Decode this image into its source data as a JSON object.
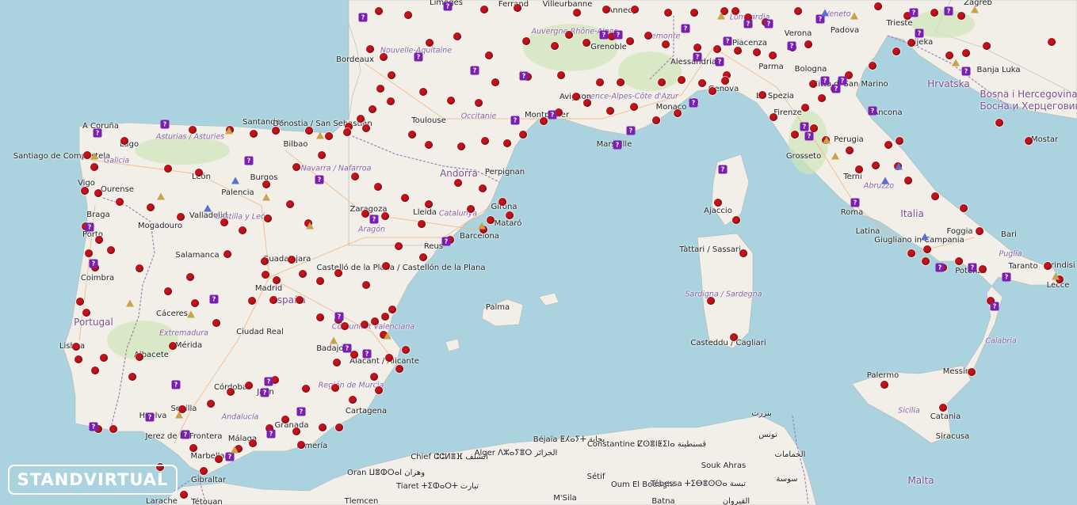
{
  "logo": {
    "text": "STANDVIRTUAL"
  },
  "colors": {
    "water": "#aad3df",
    "land": "#f2efe9",
    "forest": "#cfe6b6",
    "border": "#9e83b5",
    "road": "#f3b37a",
    "dot": "#c0141b",
    "pin": "#7a1fb0"
  },
  "labels": [
    {
      "text": "Limoges",
      "kind": "city"
    },
    {
      "text": "Ferrand",
      "kind": "city"
    },
    {
      "text": "Villeurbanne",
      "kind": "city"
    },
    {
      "text": "Annecy",
      "kind": "city"
    },
    {
      "text": "Zagreb",
      "kind": "city"
    },
    {
      "text": "Nouvelle-Aquitaine",
      "kind": "region"
    },
    {
      "text": "Bordeaux",
      "kind": "city"
    },
    {
      "text": "Grenoble",
      "kind": "city"
    },
    {
      "text": "Auvergne-Rhône-Alpes",
      "kind": "region"
    },
    {
      "text": "Piemonte",
      "kind": "region"
    },
    {
      "text": "Lombardia",
      "kind": "region"
    },
    {
      "text": "Verona",
      "kind": "city"
    },
    {
      "text": "Padova",
      "kind": "city"
    },
    {
      "text": "Veneto",
      "kind": "region"
    },
    {
      "text": "Trieste",
      "kind": "city"
    },
    {
      "text": "Rijeka",
      "kind": "city"
    },
    {
      "text": "Banja Luka",
      "kind": "city"
    },
    {
      "text": "Alessandria",
      "kind": "city"
    },
    {
      "text": "Piacenza",
      "kind": "city"
    },
    {
      "text": "Parma",
      "kind": "city"
    },
    {
      "text": "Bologna",
      "kind": "city"
    },
    {
      "text": "Città di San Marino",
      "kind": "city"
    },
    {
      "text": "Hrvatska",
      "kind": "country"
    },
    {
      "text": "Bosna i Hercegovina",
      "kind": "country"
    },
    {
      "text": "Босна и Херцеговина",
      "kind": "country"
    },
    {
      "text": "Provence-Alpes-Côte d'Azur",
      "kind": "region"
    },
    {
      "text": "Avignon",
      "kind": "city"
    },
    {
      "text": "Montpellier",
      "kind": "city"
    },
    {
      "text": "Occitanie",
      "kind": "region"
    },
    {
      "text": "Toulouse",
      "kind": "city"
    },
    {
      "text": "Monaco",
      "kind": "city"
    },
    {
      "text": "Genova",
      "kind": "city"
    },
    {
      "text": "La Spezia",
      "kind": "city"
    },
    {
      "text": "Firenze",
      "kind": "city"
    },
    {
      "text": "Ancona",
      "kind": "city"
    },
    {
      "text": "A Coruña",
      "kind": "city"
    },
    {
      "text": "Asturias / Asturies",
      "kind": "region"
    },
    {
      "text": "Santander",
      "kind": "city"
    },
    {
      "text": "Donostia / San Sebastián",
      "kind": "city"
    },
    {
      "text": "Lugo",
      "kind": "city"
    },
    {
      "text": "Bilbao",
      "kind": "city"
    },
    {
      "text": "Marseille",
      "kind": "city"
    },
    {
      "text": "Perugia",
      "kind": "city"
    },
    {
      "text": "Mostar",
      "kind": "city"
    },
    {
      "text": "Santiago de Compostela",
      "kind": "city"
    },
    {
      "text": "Galicia",
      "kind": "region"
    },
    {
      "text": "Navarra / Nafarroa",
      "kind": "region"
    },
    {
      "text": "Andorra",
      "kind": "country"
    },
    {
      "text": "Grosseto",
      "kind": "city"
    },
    {
      "text": "Vigo",
      "kind": "city"
    },
    {
      "text": "León",
      "kind": "city"
    },
    {
      "text": "Burgos",
      "kind": "city"
    },
    {
      "text": "Perpignan",
      "kind": "city"
    },
    {
      "text": "Ourense",
      "kind": "city"
    },
    {
      "text": "Palencia",
      "kind": "city"
    },
    {
      "text": "Terni",
      "kind": "city"
    },
    {
      "text": "Abruzzo",
      "kind": "region"
    },
    {
      "text": "Zaragoza",
      "kind": "city"
    },
    {
      "text": "Girona",
      "kind": "city"
    },
    {
      "text": "Ajaccio",
      "kind": "city"
    },
    {
      "text": "Braga",
      "kind": "city"
    },
    {
      "text": "Valladolid",
      "kind": "city"
    },
    {
      "text": "Castilla y León",
      "kind": "region"
    },
    {
      "text": "Lleida",
      "kind": "city"
    },
    {
      "text": "Catalunya",
      "kind": "region"
    },
    {
      "text": "Roma",
      "kind": "city"
    },
    {
      "text": "Italia",
      "kind": "country"
    },
    {
      "text": "Mogadouro",
      "kind": "city"
    },
    {
      "text": "Aragón",
      "kind": "region"
    },
    {
      "text": "Mataró",
      "kind": "city"
    },
    {
      "text": "Porto",
      "kind": "city"
    },
    {
      "text": "Barcelona",
      "kind": "city"
    },
    {
      "text": "Latina",
      "kind": "city"
    },
    {
      "text": "Foggia",
      "kind": "city"
    },
    {
      "text": "Bari",
      "kind": "city"
    },
    {
      "text": "Tàttari / Sassari",
      "kind": "city"
    },
    {
      "text": "Giugliano in Campania",
      "kind": "city"
    },
    {
      "text": "Puglia",
      "kind": "region"
    },
    {
      "text": "Salamanca",
      "kind": "city"
    },
    {
      "text": "Guadalajara",
      "kind": "city"
    },
    {
      "text": "Reus",
      "kind": "city"
    },
    {
      "text": "Coimbra",
      "kind": "city"
    },
    {
      "text": "Castelló de la Plana / Castellón de la Plana",
      "kind": "city"
    },
    {
      "text": "Potenza",
      "kind": "city"
    },
    {
      "text": "Taranto",
      "kind": "city"
    },
    {
      "text": "Brindisi",
      "kind": "city"
    },
    {
      "text": "Madrid",
      "kind": "city"
    },
    {
      "text": "España",
      "kind": "country"
    },
    {
      "text": "Sardigna / Sardegna",
      "kind": "region"
    },
    {
      "text": "Lecce",
      "kind": "city"
    },
    {
      "text": "Palma",
      "kind": "city"
    },
    {
      "text": "Portugal",
      "kind": "country"
    },
    {
      "text": "Cáceres",
      "kind": "city"
    },
    {
      "text": "Ciudad Real",
      "kind": "city"
    },
    {
      "text": "Comunitat Valenciana",
      "kind": "region"
    },
    {
      "text": "Extremadura",
      "kind": "region"
    },
    {
      "text": "Casteddu / Cagliari",
      "kind": "city"
    },
    {
      "text": "Calabria",
      "kind": "region"
    },
    {
      "text": "Lisboa",
      "kind": "city"
    },
    {
      "text": "Mérida",
      "kind": "city"
    },
    {
      "text": "Albacete",
      "kind": "city"
    },
    {
      "text": "Badajoz",
      "kind": "city"
    },
    {
      "text": "Alacant / Alicante",
      "kind": "city"
    },
    {
      "text": "Messina",
      "kind": "city"
    },
    {
      "text": "Palermo",
      "kind": "city"
    },
    {
      "text": "Córdoba",
      "kind": "city"
    },
    {
      "text": "Jaén",
      "kind": "city"
    },
    {
      "text": "Región de Murcia",
      "kind": "region"
    },
    {
      "text": "Sevilla",
      "kind": "city"
    },
    {
      "text": "Cartagena",
      "kind": "city"
    },
    {
      "text": "Huelva",
      "kind": "city"
    },
    {
      "text": "Andalucía",
      "kind": "region"
    },
    {
      "text": "Sicilia",
      "kind": "region"
    },
    {
      "text": "Catania",
      "kind": "city"
    },
    {
      "text": "Jerez de la Frontera",
      "kind": "city"
    },
    {
      "text": "Granada",
      "kind": "city"
    },
    {
      "text": "Málaga",
      "kind": "city"
    },
    {
      "text": "Siracusa",
      "kind": "city"
    },
    {
      "text": "Almería",
      "kind": "city"
    },
    {
      "text": "Marbella",
      "kind": "city"
    },
    {
      "text": "Béjaïa ⵟⵃⴰⵢⵜ بجاية",
      "kind": "city"
    },
    {
      "text": "Constantine ⵇⵙⴻⵏⵟⵉⵏⴰ قسنطينة",
      "kind": "city"
    },
    {
      "text": "بنزرت",
      "kind": "city"
    },
    {
      "text": "تونس",
      "kind": "city"
    },
    {
      "text": "الحمامات",
      "kind": "city"
    },
    {
      "text": "Chief ⵛⵛⵍⴻⴼ الشلف",
      "kind": "city"
    },
    {
      "text": "Alger ⴷⵣⴰⵢⴻⵔ الجزائر",
      "kind": "city"
    },
    {
      "text": "Sétif",
      "kind": "city"
    },
    {
      "text": "Souk Ahras",
      "kind": "city"
    },
    {
      "text": "Gibraltar",
      "kind": "city"
    },
    {
      "text": "Oran ⵡⴻⵀⵔⴰⵏ وهران",
      "kind": "city"
    },
    {
      "text": "Tiaret ⵜⵉⵀⴰⵔⵜ تيارت",
      "kind": "city"
    },
    {
      "text": "Oum El Bouaghi",
      "kind": "city"
    },
    {
      "text": "Tébessa ⵜⵉⴱⴻⵙⵙⴰ تبسة",
      "kind": "city"
    },
    {
      "text": "سوسة",
      "kind": "city"
    },
    {
      "text": "Malta",
      "kind": "country"
    },
    {
      "text": "Larache",
      "kind": "city"
    },
    {
      "text": "Tétouan",
      "kind": "city"
    },
    {
      "text": "Tlemcen",
      "kind": "city"
    },
    {
      "text": "M'Sila",
      "kind": "city"
    },
    {
      "text": "Batna",
      "kind": "city"
    },
    {
      "text": "القيروان",
      "kind": "city"
    }
  ]
}
